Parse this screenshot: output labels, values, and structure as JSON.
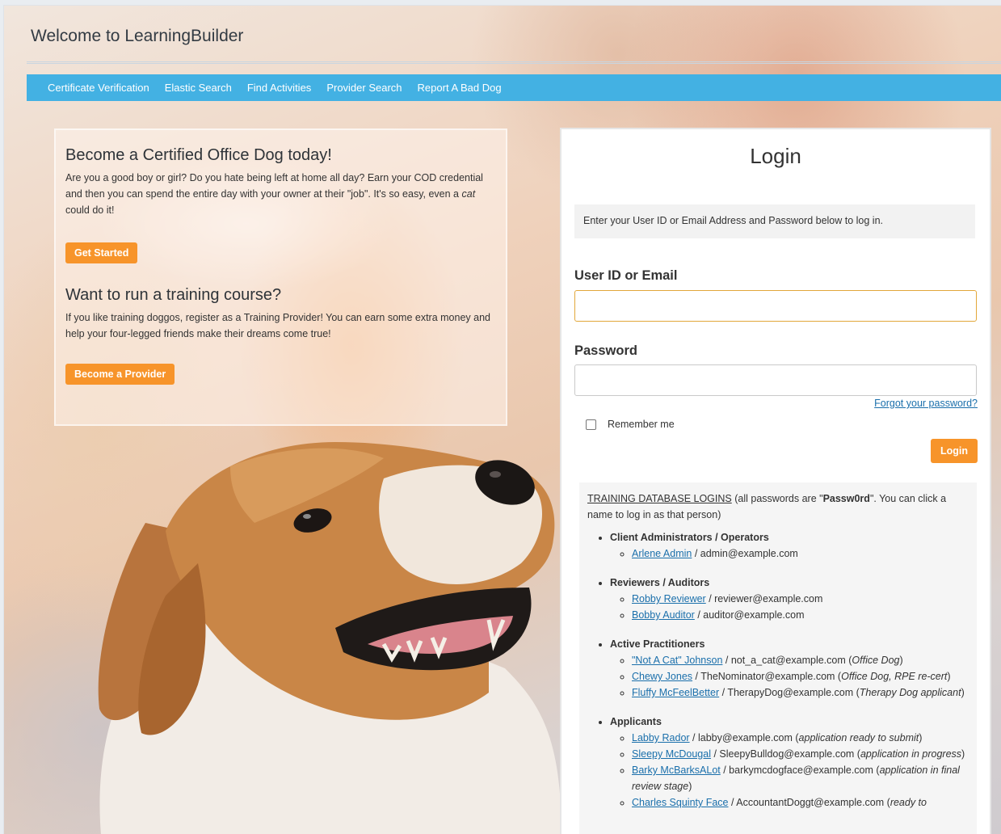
{
  "header": {
    "title": "Welcome to LearningBuilder"
  },
  "nav": {
    "items": [
      "Certificate Verification",
      "Elastic Search",
      "Find Activities",
      "Provider Search",
      "Report A Bad Dog"
    ]
  },
  "promo": {
    "heading1": "Become a Certified Office Dog today!",
    "para1_part1": "Are you a good boy or girl? Do you hate being left at home all day? Earn your COD credential and then you can spend the entire day with your owner at their \"job\". It's so easy, even a ",
    "para1_italic": "cat",
    "para1_part2": " could do it!",
    "get_started_label": "Get Started",
    "heading2": "Want to run a training course?",
    "para2": "If you like training doggos, register as a Training Provider! You can earn some extra money and help your four-legged friends make their dreams come true!",
    "become_provider_label": "Become a Provider"
  },
  "login": {
    "title": "Login",
    "instructions": "Enter your User ID or Email Address and Password below to log in.",
    "user_label": "User ID or Email",
    "user_value": "",
    "password_label": "Password",
    "password_value": "",
    "forgot_label": "Forgot your password?",
    "remember_label": "Remember me",
    "remember_checked": false,
    "button_label": "Login"
  },
  "training": {
    "heading": "TRAINING DATABASE LOGINS",
    "intro_before_pw": " (all passwords are \"",
    "password": "Passw0rd",
    "intro_after_pw": "\". You can click a name to log in as that person)",
    "groups": [
      {
        "title": "Client Administrators / Operators",
        "users": [
          {
            "name": "Arlene Admin",
            "email": " / admin@example.com",
            "note": ""
          }
        ]
      },
      {
        "title": "Reviewers / Auditors",
        "users": [
          {
            "name": "Robby Reviewer",
            "email": " / reviewer@example.com",
            "note": ""
          },
          {
            "name": "Bobby Auditor",
            "email": " / auditor@example.com",
            "note": ""
          }
        ]
      },
      {
        "title": "Active Practitioners",
        "users": [
          {
            "name": "\"Not A Cat\" Johnson",
            "email": " / not_a_cat@example.com (",
            "note": "Office Dog",
            "close": ")"
          },
          {
            "name": "Chewy Jones",
            "email": " / TheNominator@example.com (",
            "note": "Office Dog, RPE re-cert",
            "close": ")"
          },
          {
            "name": "Fluffy McFeelBetter",
            "email": " / TherapyDog@example.com (",
            "note": "Therapy Dog applicant",
            "close": ")"
          }
        ]
      },
      {
        "title": "Applicants",
        "users": [
          {
            "name": "Labby Rador",
            "email": " / labby@example.com (",
            "note": "application ready to submit",
            "close": ")"
          },
          {
            "name": "Sleepy McDougal",
            "email": " / SleepyBulldog@example.com (",
            "note": "application in progress",
            "close": ")"
          },
          {
            "name": "Barky McBarksALot",
            "email": " / barkymcdogface@example.com (",
            "note": "application in final review stage",
            "close": ")"
          },
          {
            "name": "Charles Squinty Face",
            "email": " / AccountantDoggt@example.com (",
            "note": "ready to",
            "close": ""
          }
        ]
      }
    ]
  }
}
